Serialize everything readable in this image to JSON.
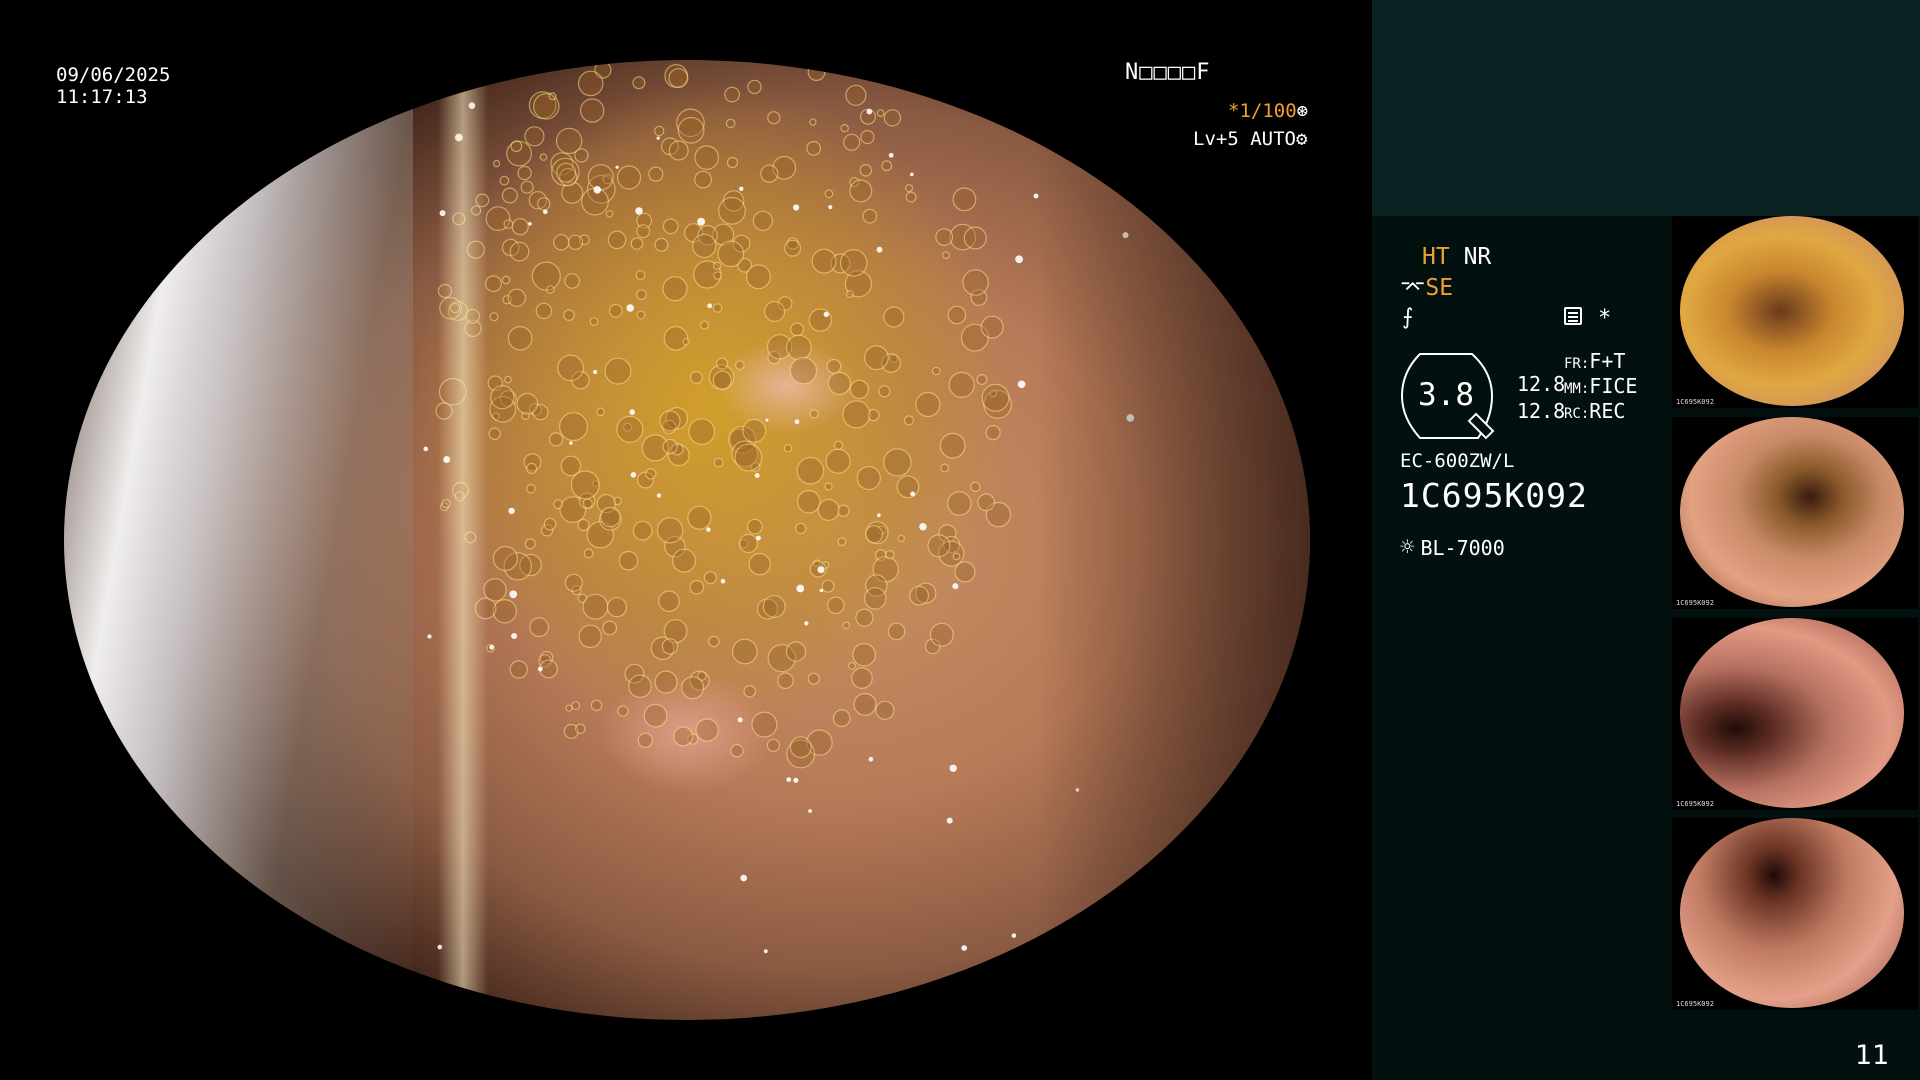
{
  "overlay": {
    "date": "09/06/2025",
    "time": "11:17:13",
    "code": "N□□□□F",
    "shutter": "*1/100",
    "shutter_icon": "aperture-icon",
    "level": "Lv+5 AUTO",
    "level_icon": "settings-icon"
  },
  "panel": {
    "ht": "HT",
    "nr": "NR",
    "se": "SE",
    "se_icon": "enhancement-icon",
    "zoom": "3.8",
    "val1": "12.8",
    "val2": "12.8",
    "fr_label": "FR:",
    "fr_value": "F+T",
    "mm_label": "MM:",
    "mm_value": "FICE",
    "rc_label": "RC:",
    "rc_value": "REC",
    "model": "EC-600ZW/L",
    "serial": "1C695K092",
    "light": "BL-7000",
    "light_icon": "light-source-icon"
  },
  "thumbnails": [
    {
      "meta": "1C695K092"
    },
    {
      "meta": "1C695K092"
    },
    {
      "meta": "1C695K092"
    },
    {
      "meta": "1C695K092"
    }
  ],
  "page_number": "11",
  "colors": {
    "accent_orange": "#f0a030",
    "panel_bg": "#031010",
    "panel_top_bg": "#0b2222"
  }
}
